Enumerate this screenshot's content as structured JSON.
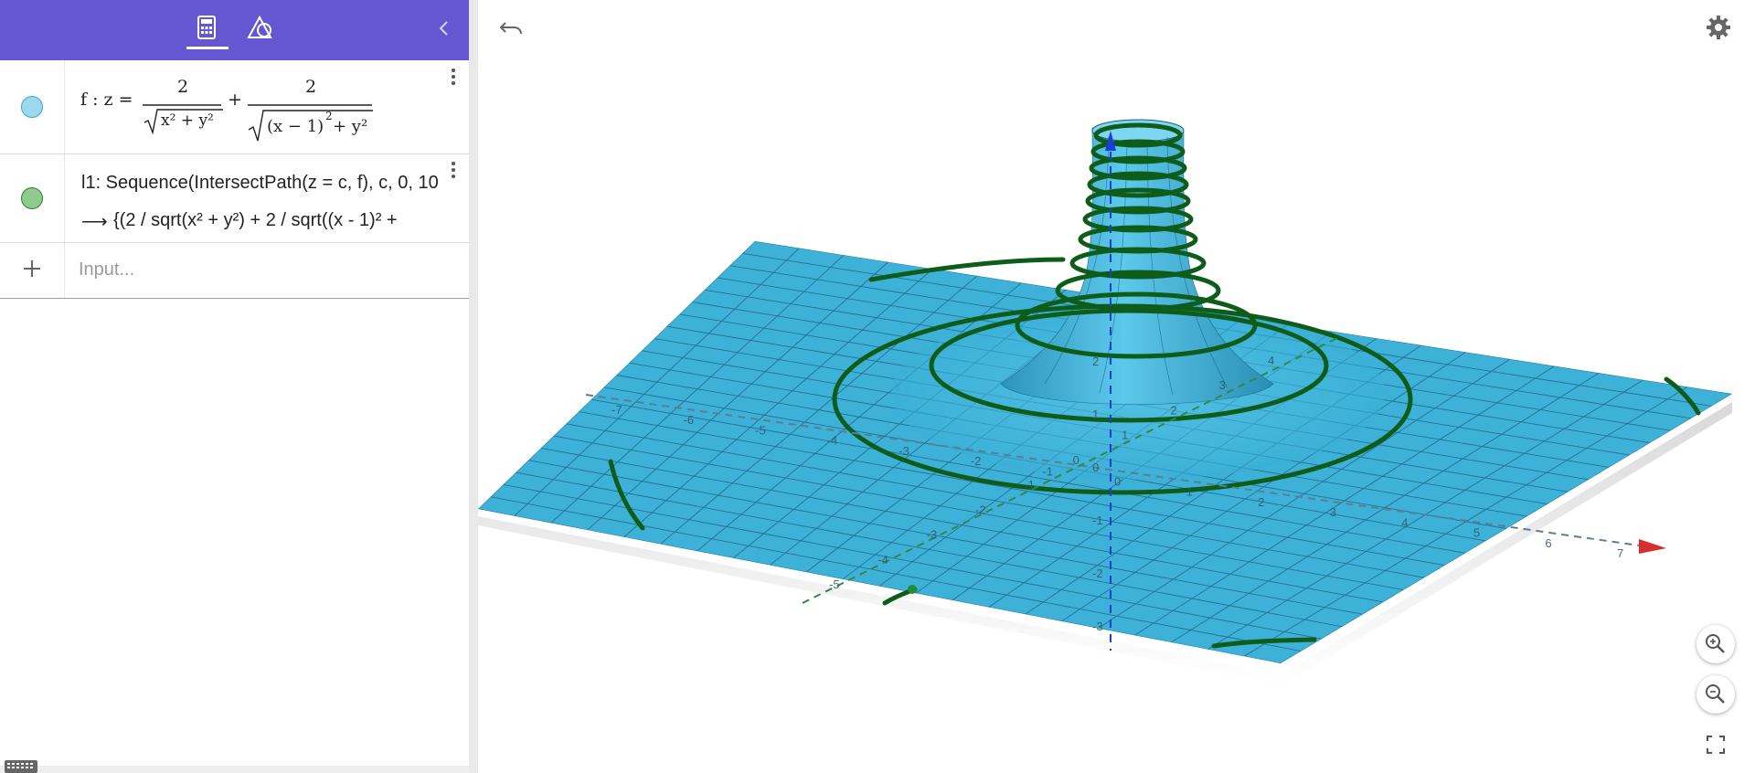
{
  "algebra": {
    "rows": [
      {
        "name": "f",
        "color": "#9cd9ef",
        "prefix": "f : z =",
        "numerator1": "2",
        "radicand1": "x² + y²",
        "plus": "+",
        "numerator2": "2",
        "radicand2_a": "(x − 1)",
        "radicand2_b": "2",
        "radicand2_c": " + y²"
      },
      {
        "name": "l1",
        "color": "#8fc98e",
        "definition": "l1: Sequence(IntersectPath(z = c, f), c, 0, 10",
        "arrow": "⟶",
        "value": "{(2 / sqrt(x² + y²) + 2 / sqrt((x - 1)² +"
      }
    ],
    "input": {
      "placeholder": "Input..."
    }
  },
  "graphics": {
    "surface_color": "#3fb2d8",
    "curve_color": "#0d5c1a",
    "axis_colors": {
      "x": "#d62d2d",
      "y": "#1f8e3a",
      "z": "#1a3fd6"
    },
    "x_tick_labels": [
      "-7",
      "-6",
      "-5",
      "-4",
      "-3",
      "-2",
      "-1",
      "0",
      "1",
      "2",
      "3",
      "4",
      "5",
      "6",
      "7"
    ],
    "y_tick_labels": [
      "-5",
      "-4",
      "-3",
      "-2",
      "-1",
      "0",
      "1",
      "2",
      "3",
      "4"
    ],
    "z_tick_labels": [
      "-3",
      "-2",
      "-1",
      "0",
      "1",
      "2"
    ],
    "x_label_last": "7",
    "z_label_last": "-3"
  },
  "icons": {
    "algebra_tab": "calculator-icon",
    "tools_tab": "shapes-icon",
    "collapse": "chevron-left-icon",
    "undo": "undo-icon",
    "settings": "gear-icon",
    "zoom_in": "zoom-in-icon",
    "zoom_out": "zoom-out-icon",
    "fullscreen": "fullscreen-icon",
    "keyboard": "keyboard-icon"
  }
}
